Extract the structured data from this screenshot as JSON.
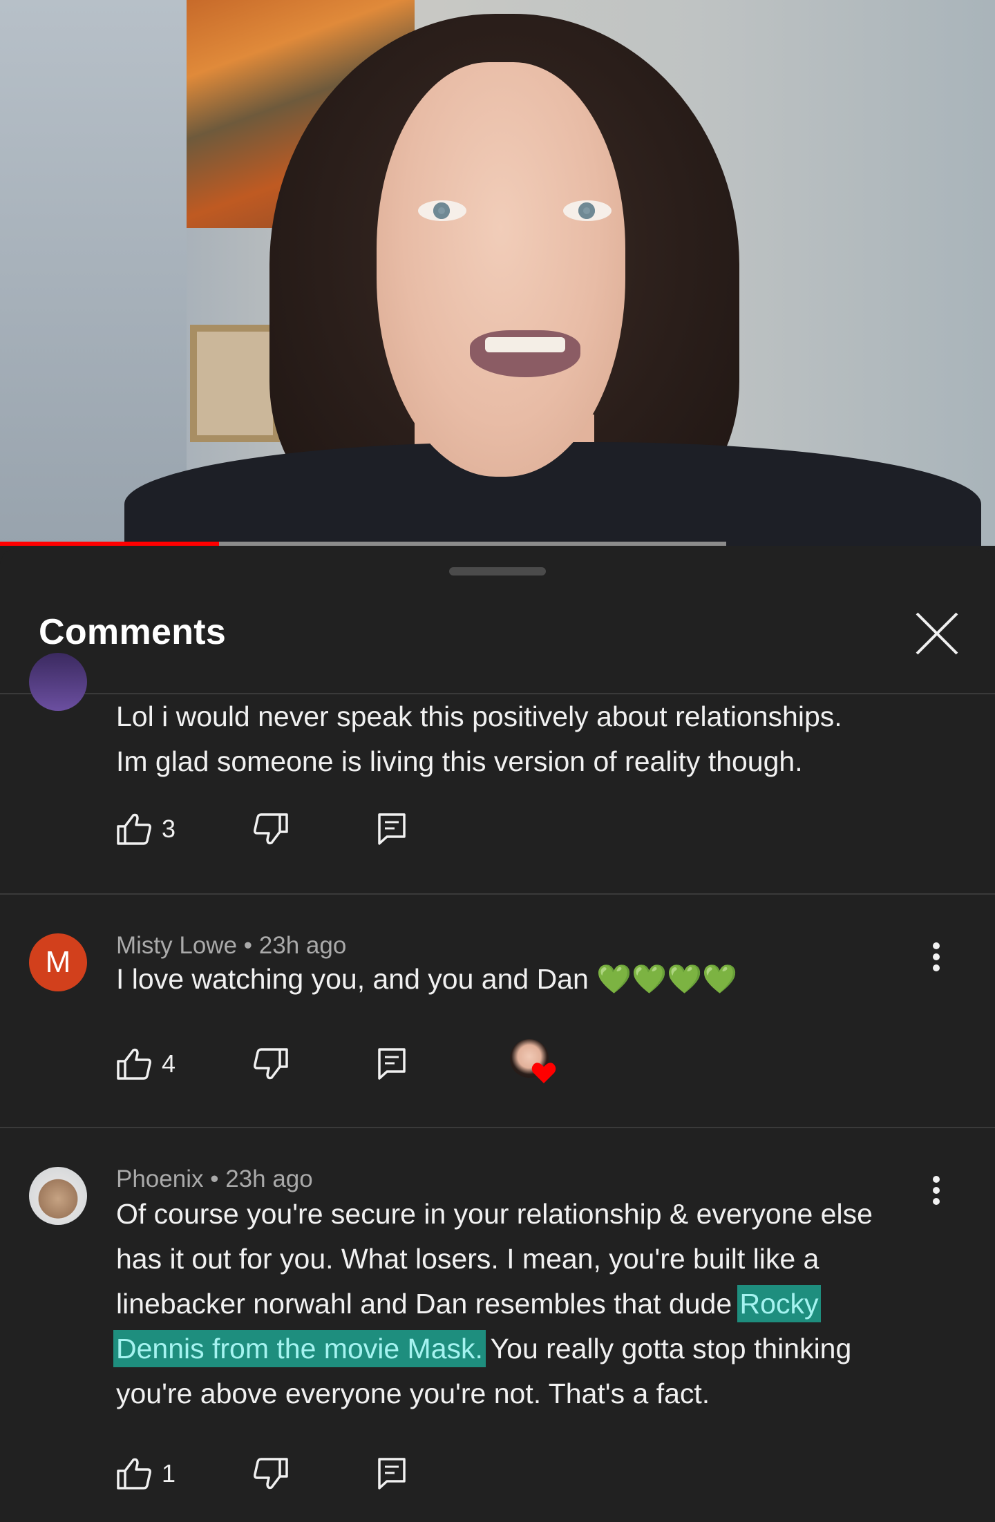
{
  "video": {
    "progress_fraction": 0.22,
    "buffered_fraction": 0.73,
    "colors": {
      "progress": "#ff0000",
      "buffered": "#8c8c8c"
    }
  },
  "sheet": {
    "title": "Comments",
    "close_icon": "close-icon"
  },
  "comments": [
    {
      "author": "",
      "time": "",
      "lines": [
        "Lol i would never speak this positively about relationships.",
        "Im glad someone is living this version of reality though."
      ],
      "likes": "3"
    },
    {
      "author": "Misty Lowe",
      "separator": "•",
      "time": "23h ago",
      "avatar_letter": "M",
      "text": "I love watching you, and you and Dan 💚💚💚💚",
      "likes": "4",
      "creator_heart": true
    },
    {
      "author": "Phoenix",
      "separator": "•",
      "time": "23h ago",
      "text_before": "Of course you're secure in your relationship & everyone else has it out for you.  What losers. I mean,  you're built like a linebacker norwahl and Dan resembles that dude ",
      "text_highlight_1": "Rocky",
      "text_highlight_2": "Dennis from the movie Mask.",
      "text_after": " You really gotta stop thinking you're above everyone you're not. That's a fact.",
      "likes": "1"
    }
  ],
  "colors": {
    "background": "#212121",
    "divider": "#3a3a3a",
    "highlight": "#1e8e7e",
    "highlight_text": "#a5f3f0",
    "avatar_m": "#d2401c",
    "heart": "#ff0000"
  }
}
